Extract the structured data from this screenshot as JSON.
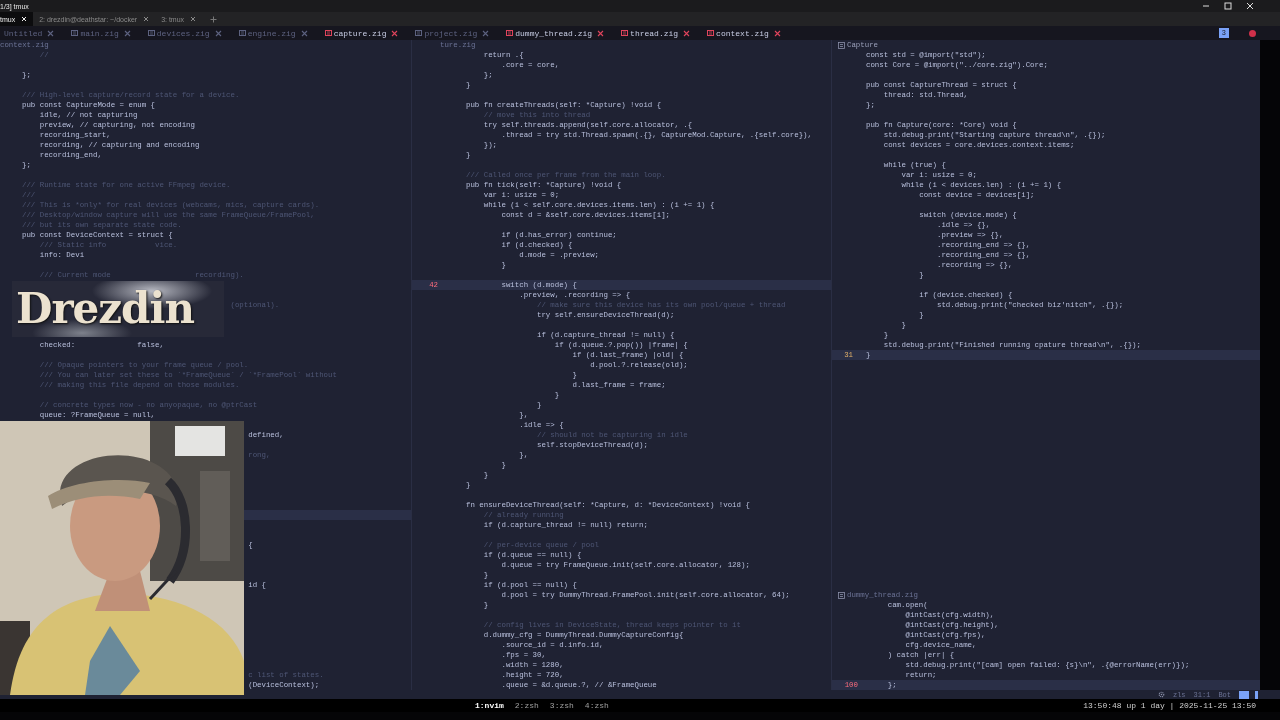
{
  "window": {
    "title": "1/3] tmux"
  },
  "terminal_tabs": [
    {
      "label": "tmux",
      "selected": true
    },
    {
      "label": "2: drezdin@deathstar: ~/docker",
      "selected": false
    },
    {
      "label": "3: tmux",
      "selected": false
    }
  ],
  "editor_tabs": [
    {
      "label": "Untitled",
      "shown": false
    },
    {
      "label": "main.zig",
      "shown": false
    },
    {
      "label": "devices.zig",
      "shown": false
    },
    {
      "label": "engine.zig",
      "shown": false
    },
    {
      "label": "capture.zig",
      "shown": true
    },
    {
      "label": "project.zig",
      "shown": false
    },
    {
      "label": "dummy_thread.zig",
      "shown": true
    },
    {
      "label": "thread.zig",
      "shown": true
    },
    {
      "label": "context.zig",
      "shown": true
    }
  ],
  "buffer_badge": "3",
  "left_pane": {
    "header": {
      "label": "context.zig"
    },
    "lines": [
      {
        "t": "    //",
        "kind": "comment"
      },
      {
        "kind": "blank"
      },
      {
        "t": "};",
        "kind": "code"
      },
      {
        "kind": "blank"
      },
      {
        "t": "/// High-level capture/record state for a device.",
        "kind": "comment"
      },
      {
        "t": "pub const CaptureMode = enum {",
        "kind": "code"
      },
      {
        "t": "    idle, // not capturing",
        "kind": "code"
      },
      {
        "t": "    preview, // capturing, not encoding",
        "kind": "code"
      },
      {
        "t": "    recording_start,",
        "kind": "code"
      },
      {
        "t": "    recording, // capturing and encoding",
        "kind": "code"
      },
      {
        "t": "    recording_end,",
        "kind": "code"
      },
      {
        "t": "};",
        "kind": "code"
      },
      {
        "kind": "blank"
      },
      {
        "t": "/// Runtime state for one active FFmpeg device.",
        "kind": "comment"
      },
      {
        "t": "///",
        "kind": "comment"
      },
      {
        "t": "/// This is *only* for real devices (webcams, mics, capture cards).",
        "kind": "comment"
      },
      {
        "t": "/// Desktop/window capture will use the same FrameQueue/FramePool,",
        "kind": "comment"
      },
      {
        "t": "/// but its own separate state code.",
        "kind": "comment"
      },
      {
        "t": "pub const DeviceContext = struct {",
        "kind": "code"
      },
      {
        "t": "    /// Static info           vice.",
        "kind": "comment"
      },
      {
        "t": "    info: Devi",
        "kind": "code"
      },
      {
        "kind": "blank"
      },
      {
        "t": "    /// Current mode                   recording).",
        "kind": "comment"
      },
      {
        "kind": "blank"
      },
      {
        "kind": "blank"
      },
      {
        "t": "                                               (optional).",
        "kind": "comment"
      },
      {
        "kind": "blank"
      },
      {
        "kind": "blank"
      },
      {
        "kind": "blank"
      },
      {
        "t": "    checked:              false,",
        "kind": "code"
      },
      {
        "kind": "blank"
      },
      {
        "t": "    /// Opaque pointers to your frame queue / pool.",
        "kind": "comment"
      },
      {
        "t": "    /// You can later set these to `*FrameQueue` / `*FramePool` without",
        "kind": "comment"
      },
      {
        "t": "    /// making this file depend on those modules.",
        "kind": "comment"
      },
      {
        "kind": "blank"
      },
      {
        "t": "    // concrete types now - no anyopaque, no @ptrCast",
        "kind": "comment"
      },
      {
        "t": "    queue: ?FrameQueue = null,",
        "kind": "code"
      },
      {
        "kind": "blank"
      },
      {
        "t": "                                                   defined,",
        "kind": "code"
      },
      {
        "kind": "blank"
      },
      {
        "t": "                                                   rong,",
        "kind": "comment"
      },
      {
        "kind": "blank"
      },
      {
        "kind": "blank"
      },
      {
        "kind": "blank"
      },
      {
        "kind": "blank"
      },
      {
        "kind": "blank"
      },
      {
        "kind": "current"
      },
      {
        "kind": "blank"
      },
      {
        "kind": "blank"
      },
      {
        "t": "                                                   {",
        "kind": "code"
      },
      {
        "kind": "blank"
      },
      {
        "kind": "blank"
      },
      {
        "kind": "blank"
      },
      {
        "t": "                                                   id {",
        "kind": "code"
      },
      {
        "kind": "blank"
      },
      {
        "kind": "blank"
      },
      {
        "kind": "blank"
      },
      {
        "kind": "blank"
      },
      {
        "kind": "blank"
      },
      {
        "kind": "blank"
      },
      {
        "kind": "blank"
      },
      {
        "kind": "blank"
      },
      {
        "t": "                                                   c list of states.",
        "kind": "comment"
      },
      {
        "t": "                                                   (DeviceContext);",
        "kind": "code"
      }
    ]
  },
  "middle_pane": {
    "header": {
      "label": "ture.zig"
    },
    "cursor_number": "42",
    "lines": [
      {
        "t": "    return .{",
        "kind": "code"
      },
      {
        "t": "        .core = core,",
        "kind": "code"
      },
      {
        "t": "    };",
        "kind": "code"
      },
      {
        "t": "}",
        "kind": "code"
      },
      {
        "kind": "blank"
      },
      {
        "t": "pub fn createThreads(self: *Capture) !void {",
        "kind": "code"
      },
      {
        "t": "    // move this into thread",
        "kind": "comment"
      },
      {
        "t": "    try self.threads.append(self.core.allocator, .{",
        "kind": "code"
      },
      {
        "t": "        .thread = try std.Thread.spawn(.{}, CaptureMod.Capture, .{self.core}),",
        "kind": "code"
      },
      {
        "t": "    });",
        "kind": "code"
      },
      {
        "t": "}",
        "kind": "code"
      },
      {
        "kind": "blank"
      },
      {
        "t": "/// Called once per frame from the main loop.",
        "kind": "comment"
      },
      {
        "t": "pub fn tick(self: *Capture) !void {",
        "kind": "code"
      },
      {
        "t": "    var i: usize = 0;",
        "kind": "code"
      },
      {
        "t": "    while (i < self.core.devices.items.len) : (i += 1) {",
        "kind": "code"
      },
      {
        "t": "        const d = &self.core.devices.items[i];",
        "kind": "code"
      },
      {
        "kind": "blank"
      },
      {
        "t": "        if (d.has_error) continue;",
        "kind": "code"
      },
      {
        "t": "        if (d.checked) {",
        "kind": "code"
      },
      {
        "t": "            d.mode = .preview;",
        "kind": "code"
      },
      {
        "t": "        }",
        "kind": "code"
      },
      {
        "kind": "blank"
      },
      {
        "t": "        switch (d.mode) {",
        "kind": "current"
      },
      {
        "t": "            .preview, .recording => {",
        "kind": "code"
      },
      {
        "t": "                // make sure this device has its own pool/queue + thread",
        "kind": "comment"
      },
      {
        "t": "                try self.ensureDeviceThread(d);",
        "kind": "code"
      },
      {
        "kind": "blank"
      },
      {
        "t": "                if (d.capture_thread != null) {",
        "kind": "code"
      },
      {
        "t": "                    if (d.queue.?.pop()) |frame| {",
        "kind": "code"
      },
      {
        "t": "                        if (d.last_frame) |old| {",
        "kind": "code"
      },
      {
        "t": "                            d.pool.?.release(old);",
        "kind": "code"
      },
      {
        "t": "                        }",
        "kind": "code"
      },
      {
        "t": "                        d.last_frame = frame;",
        "kind": "code"
      },
      {
        "t": "                    }",
        "kind": "code"
      },
      {
        "t": "                }",
        "kind": "code"
      },
      {
        "t": "            },",
        "kind": "code"
      },
      {
        "t": "            .idle => {",
        "kind": "code"
      },
      {
        "t": "                // should not be capturing in idle",
        "kind": "comment"
      },
      {
        "t": "                self.stopDeviceThread(d);",
        "kind": "code"
      },
      {
        "t": "            },",
        "kind": "code"
      },
      {
        "t": "        }",
        "kind": "code"
      },
      {
        "t": "    }",
        "kind": "code"
      },
      {
        "t": "}",
        "kind": "code"
      },
      {
        "kind": "blank"
      },
      {
        "t": "fn ensureDeviceThread(self: *Capture, d: *DeviceContext) !void {",
        "kind": "code"
      },
      {
        "t": "    // already running",
        "kind": "comment"
      },
      {
        "t": "    if (d.capture_thread != null) return;",
        "kind": "code"
      },
      {
        "kind": "blank"
      },
      {
        "t": "    // per-device queue / pool",
        "kind": "comment"
      },
      {
        "t": "    if (d.queue == null) {",
        "kind": "code"
      },
      {
        "t": "        d.queue = try FrameQueue.init(self.core.allocator, 128);",
        "kind": "code"
      },
      {
        "t": "    }",
        "kind": "code"
      },
      {
        "t": "    if (d.pool == null) {",
        "kind": "code"
      },
      {
        "t": "        d.pool = try DummyThread.FramePool.init(self.core.allocator, 64);",
        "kind": "code"
      },
      {
        "t": "    }",
        "kind": "code"
      },
      {
        "kind": "blank"
      },
      {
        "t": "    // config lives in DeviceState, thread keeps pointer to it",
        "kind": "comment"
      },
      {
        "t": "    d.dummy_cfg = DummyThread.DummyCaptureConfig{",
        "kind": "code"
      },
      {
        "t": "        .source_id = d.info.id,",
        "kind": "code"
      },
      {
        "t": "        .fps = 30,",
        "kind": "code"
      },
      {
        "t": "        .width = 1280,",
        "kind": "code"
      },
      {
        "t": "        .height = 720,",
        "kind": "code"
      },
      {
        "t": "        .queue = &d.queue.?, // &FrameQueue",
        "kind": "code"
      }
    ]
  },
  "right_top_pane": {
    "header": {
      "label": "Capture",
      "icon": true
    },
    "cursor_number": "31",
    "lines": [
      {
        "t": "const std = @import(\"std\");",
        "kind": "code"
      },
      {
        "t": "const Core = @import(\"../core.zig\").Core;",
        "kind": "code"
      },
      {
        "kind": "blank"
      },
      {
        "t": "pub const CaptureThread = struct {",
        "kind": "code"
      },
      {
        "t": "    thread: std.Thread,",
        "kind": "code"
      },
      {
        "t": "};",
        "kind": "code"
      },
      {
        "kind": "blank"
      },
      {
        "t": "pub fn Capture(core: *Core) void {",
        "kind": "code"
      },
      {
        "t": "    std.debug.print(\"Starting capture thread\\n\", .{});",
        "kind": "code"
      },
      {
        "t": "    const devices = core.devices.context.items;",
        "kind": "code"
      },
      {
        "kind": "blank"
      },
      {
        "t": "    while (true) {",
        "kind": "code"
      },
      {
        "t": "        var i: usize = 0;",
        "kind": "code"
      },
      {
        "t": "        while (i < devices.len) : (i += 1) {",
        "kind": "code"
      },
      {
        "t": "            const device = devices[i];",
        "kind": "code"
      },
      {
        "kind": "blank"
      },
      {
        "t": "            switch (device.mode) {",
        "kind": "code"
      },
      {
        "t": "                .idle => {},",
        "kind": "code"
      },
      {
        "t": "                .preview => {},",
        "kind": "code"
      },
      {
        "t": "                .recording_end => {},",
        "kind": "code"
      },
      {
        "t": "                .recording_end => {},",
        "kind": "code"
      },
      {
        "t": "                .recording => {},",
        "kind": "code"
      },
      {
        "t": "            }",
        "kind": "code"
      },
      {
        "kind": "blank"
      },
      {
        "t": "            if (device.checked) {",
        "kind": "code"
      },
      {
        "t": "                std.debug.print(\"checked biz'nitch\", .{});",
        "kind": "code"
      },
      {
        "t": "            }",
        "kind": "code"
      },
      {
        "t": "        }",
        "kind": "code"
      },
      {
        "t": "    }",
        "kind": "code"
      },
      {
        "t": "    std.debug.print(\"Finished running cpature thread\\n\", .{});",
        "kind": "code"
      },
      {
        "t": "}",
        "kind": "current"
      }
    ]
  },
  "right_bottom_pane": {
    "header": {
      "label": "dummy_thread.zig",
      "icon": true
    },
    "cursor_number": "100",
    "lines": [
      {
        "t": "    cam.open(",
        "kind": "code"
      },
      {
        "t": "        @intCast(cfg.width),",
        "kind": "code"
      },
      {
        "t": "        @intCast(cfg.height),",
        "kind": "code"
      },
      {
        "t": "        @intCast(cfg.fps),",
        "kind": "code"
      },
      {
        "t": "        cfg.device_name,",
        "kind": "code"
      },
      {
        "t": "    ) catch |err| {",
        "kind": "code"
      },
      {
        "t": "        std.debug.print(\"[cam] open failed: {s}\\n\", .{@errorName(err)});",
        "kind": "code"
      },
      {
        "t": "        return;",
        "kind": "code"
      },
      {
        "t": "    };",
        "kind": "current"
      }
    ]
  },
  "status_line": {
    "lsp": "zls",
    "position": "31:1",
    "scroll": "Bot"
  },
  "overlay_logo": {
    "text": "Drezdin"
  },
  "tmux_bar": {
    "windows": [
      {
        "label": "1:nvim",
        "selected": true
      },
      {
        "label": "2:zsh",
        "selected": false
      },
      {
        "label": "3:zsh",
        "selected": false
      },
      {
        "label": "4:zsh",
        "selected": false
      }
    ],
    "status": "13:50:48 up 1 day | 2025-11-25 13:50"
  }
}
